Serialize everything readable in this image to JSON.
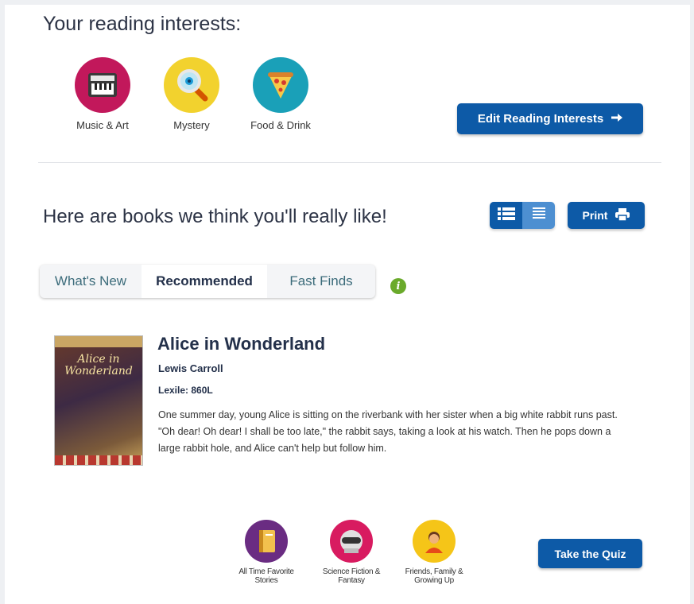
{
  "interests": {
    "heading": "Your reading interests:",
    "items": [
      {
        "label": "Music & Art",
        "icon": "piano-icon",
        "color": "#c2185b"
      },
      {
        "label": "Mystery",
        "icon": "magnifier-icon",
        "color": "#f2d22e"
      },
      {
        "label": "Food & Drink",
        "icon": "pizza-icon",
        "color": "#1aa0b8"
      }
    ],
    "edit_button": "Edit Reading Interests"
  },
  "recommendations": {
    "heading": "Here are books we think you'll really like!",
    "print_label": "Print",
    "tabs": [
      {
        "label": "What's New",
        "active": false
      },
      {
        "label": "Recommended",
        "active": true
      },
      {
        "label": "Fast Finds",
        "active": false
      }
    ],
    "info_glyph": "i"
  },
  "book": {
    "title": "Alice in Wonderland",
    "author": "Lewis Carroll",
    "lexile": "Lexile: 860L",
    "description": "One summer day, young Alice is sitting on the riverbank with her sister when a big white rabbit runs past. \"Oh dear! Oh dear! I shall be too late,\" the rabbit says, taking a look at his watch. Then he pops down a large rabbit hole, and Alice can't help but follow him.",
    "cover_title": "Alice in Wonderland"
  },
  "genres": [
    {
      "label": "All Time Favorite Stories",
      "icon": "book-icon",
      "color": "#6a2c82"
    },
    {
      "label": "Science Fiction & Fantasy",
      "icon": "robot-icon",
      "color": "#d81b60"
    },
    {
      "label": "Friends, Family & Growing Up",
      "icon": "person-icon",
      "color": "#f5c518"
    }
  ],
  "quiz_button": "Take the Quiz",
  "colors": {
    "primary_button": "#0d5aa7",
    "info_green": "#6aaa2b"
  }
}
